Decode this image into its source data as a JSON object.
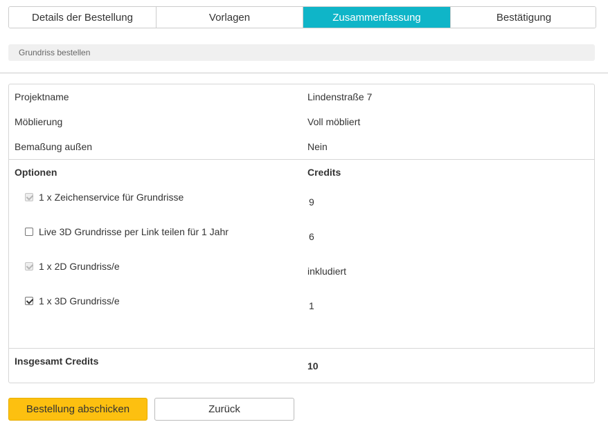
{
  "tabs": [
    {
      "label": "Details der Bestellung",
      "active": false
    },
    {
      "label": "Vorlagen",
      "active": false
    },
    {
      "label": "Zusammenfassung",
      "active": true
    },
    {
      "label": "Bestätigung",
      "active": false
    }
  ],
  "breadcrumb": "Grundriss bestellen",
  "summary": {
    "rows": [
      {
        "label": "Projektname",
        "value": "Lindenstraße 7"
      },
      {
        "label": "Möblierung",
        "value": "Voll möbliert"
      },
      {
        "label": "Bemaßung außen",
        "value": "Nein"
      }
    ],
    "options_header": "Optionen",
    "credits_header": "Credits",
    "options": [
      {
        "label": "1 x Zeichenservice für Grundrisse",
        "credits": "9",
        "checked": true,
        "disabled": true
      },
      {
        "label": "Live 3D Grundrisse per Link teilen für 1 Jahr",
        "credits": "6",
        "checked": false,
        "disabled": false
      },
      {
        "label": "1 x 2D Grundriss/e",
        "credits": "inkludiert",
        "checked": true,
        "disabled": true
      },
      {
        "label": "1 x 3D Grundriss/e",
        "credits": "1",
        "checked": true,
        "disabled": false
      }
    ],
    "total_label": "Insgesamt Credits",
    "total_value": "10"
  },
  "buttons": {
    "submit": "Bestellung abschicken",
    "back": "Zurück"
  },
  "colors": {
    "accent": "#0fb5c8",
    "primary_button": "#fdc010"
  }
}
